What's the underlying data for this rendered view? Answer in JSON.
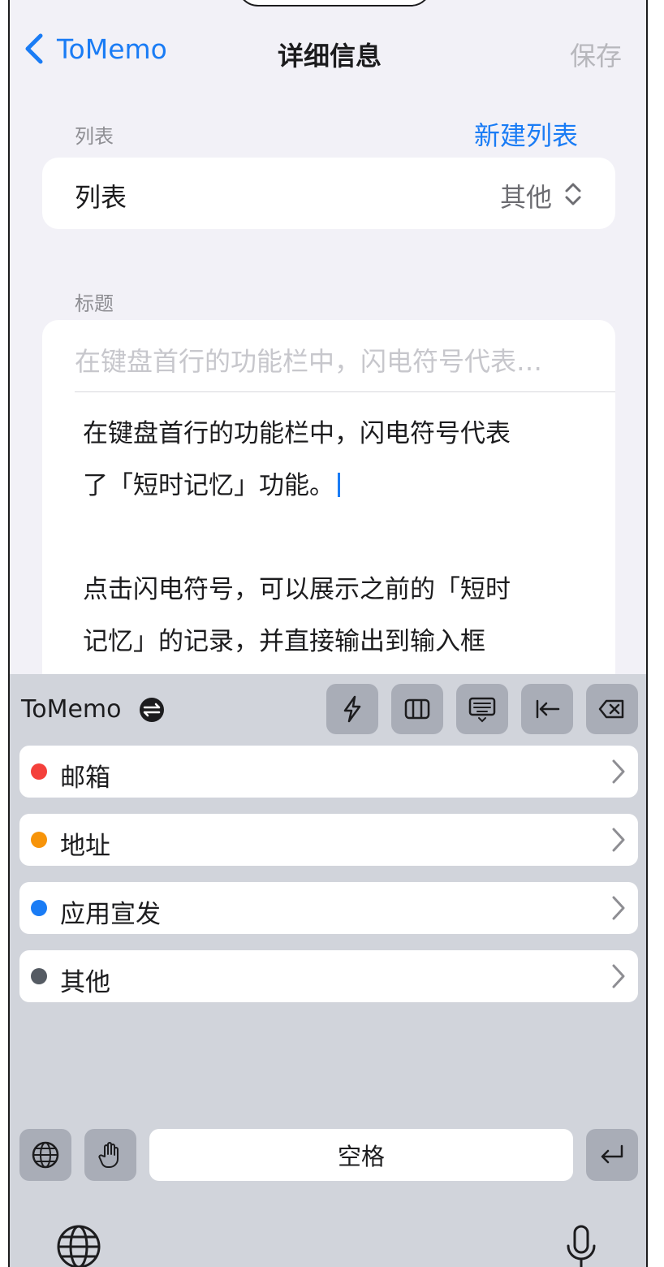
{
  "nav": {
    "back_label": "ToMemo",
    "title": "详细信息",
    "save_label": "保存"
  },
  "list_section": {
    "header": "列表",
    "new_list_label": "新建列表",
    "row_key": "列表",
    "row_value": "其他"
  },
  "title_section": {
    "header": "标题",
    "placeholder": "在键盘首行的功能栏中，闪电符号代表…",
    "body_lines": [
      "在键盘首行的功能栏中，闪电符号代表",
      "了「短时记忆」功能。",
      "",
      "点击闪电符号，可以展示之前的「短时",
      "记忆」的记录，并直接输出到输入框"
    ]
  },
  "keyboard": {
    "brand": "ToMemo",
    "toolbar_icons": [
      "lightning-icon",
      "columns-icon",
      "keyboard-dismiss-icon",
      "move-left-icon",
      "delete-icon"
    ],
    "items": [
      {
        "label": "邮箱",
        "color": "#f4403b"
      },
      {
        "label": "地址",
        "color": "#f7940a"
      },
      {
        "label": "应用宣发",
        "color": "#1a7cf5"
      },
      {
        "label": "其他",
        "color": "#555b63"
      }
    ],
    "space_label": "空格"
  }
}
